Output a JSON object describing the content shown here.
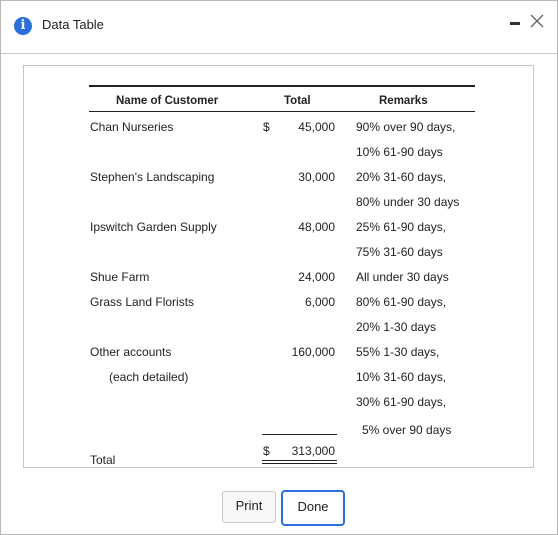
{
  "window": {
    "title": "Data Table",
    "info_icon_glyph": "i",
    "accent_color": "#2a6fdb"
  },
  "table": {
    "headers": {
      "name": "Name of Customer",
      "total": "Total",
      "remarks": "Remarks"
    },
    "currency_symbol": "$",
    "rows": [
      {
        "name": "Chan Nurseries",
        "currency": "$",
        "amount": "45,000",
        "remarks": [
          "90% over 90 days,",
          "10% 61-90 days"
        ]
      },
      {
        "name": "Stephen's Landscaping",
        "currency": "",
        "amount": "30,000",
        "remarks": [
          "20% 31-60 days,",
          "80% under 30 days"
        ]
      },
      {
        "name": "Ipswitch Garden Supply",
        "currency": "",
        "amount": "48,000",
        "remarks": [
          "25% 61-90 days,",
          "75% 31-60 days"
        ]
      },
      {
        "name": "Shue Farm",
        "currency": "",
        "amount": "24,000",
        "remarks": [
          "All under 30 days"
        ]
      },
      {
        "name": "Grass Land Florists",
        "currency": "",
        "amount": "6,000",
        "remarks": [
          "80% 61-90 days,",
          "20% 1-30 days"
        ]
      },
      {
        "name": "Other accounts",
        "sub": "(each detailed)",
        "currency": "",
        "amount": "160,000",
        "remarks": [
          "55% 1-30 days,",
          "10% 31-60 days,",
          "30% 61-90 days,",
          "5% over 90 days"
        ]
      }
    ],
    "total": {
      "label": "Total",
      "currency": "$",
      "amount": "313,000"
    }
  },
  "buttons": {
    "print": "Print",
    "done": "Done"
  }
}
